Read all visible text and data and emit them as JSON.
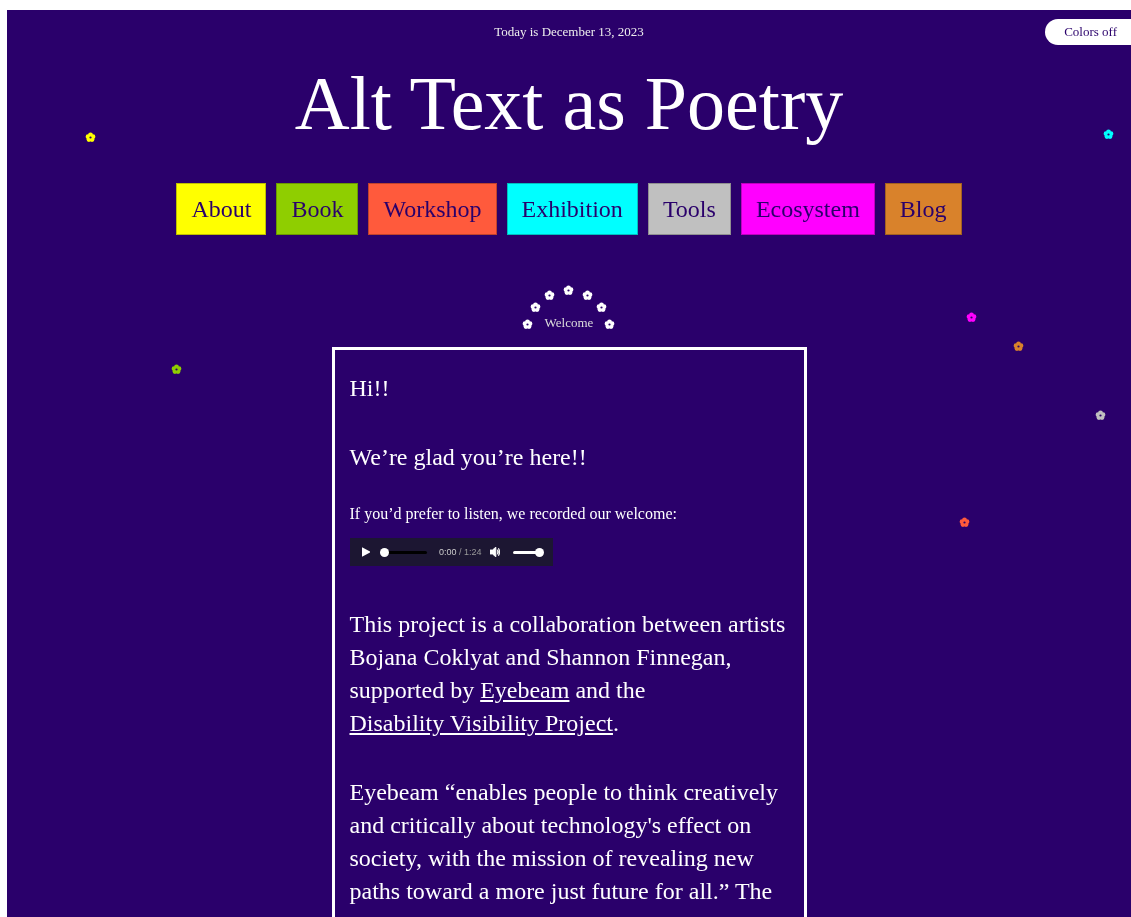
{
  "date": "Today is December 13, 2023",
  "colors_toggle": {
    "label": "Colors off"
  },
  "title": "Alt Text as Poetry",
  "nav": [
    {
      "label": "About",
      "color": "#ffff00"
    },
    {
      "label": "Book",
      "color": "#8fce00"
    },
    {
      "label": "Workshop",
      "color": "#ff5a3c"
    },
    {
      "label": "Exhibition",
      "color": "#00ffff"
    },
    {
      "label": "Tools",
      "color": "#c0c0c0"
    },
    {
      "label": "Ecosystem",
      "color": "#ff00ff"
    },
    {
      "label": "Blog",
      "color": "#d9822b"
    }
  ],
  "flowers": [
    {
      "color": "#ffff00"
    },
    {
      "color": "#00ffff"
    },
    {
      "color": "#8fce00"
    },
    {
      "color": "#ff00ff"
    },
    {
      "color": "#d9822b"
    },
    {
      "color": "#c0c0c0"
    },
    {
      "color": "#ff5a3c"
    }
  ],
  "section_label": "Welcome",
  "greeting": "Hi!!",
  "glad": "We’re glad you’re here!!",
  "listen_note": "If you’d prefer to listen, we recorded our welcome:",
  "audio": {
    "progress": {
      "level": 0
    },
    "time": "0:00",
    "separator": "/",
    "duration": "1:24",
    "volume": {
      "level": 1
    }
  },
  "paragraphs": [
    [
      {
        "kind": "text",
        "text": "This project is a collaboration between artists Bojana Coklyat and Shannon Finnegan, supported by "
      },
      {
        "kind": "link",
        "text": "Eyebeam"
      },
      {
        "kind": "text",
        "text": " and the "
      },
      {
        "kind": "link",
        "text": "Disability Visibility Project"
      },
      {
        "kind": "text",
        "text": "."
      }
    ],
    [
      {
        "kind": "text",
        "text": "Eyebeam “enables people to think creatively and critically about technology's effect on society, with the mission of revealing new paths toward a more just future for all.” The"
      }
    ]
  ]
}
